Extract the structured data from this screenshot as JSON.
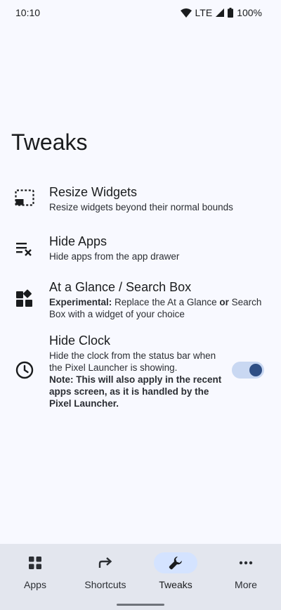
{
  "status_bar": {
    "time": "10:10",
    "network": "LTE",
    "battery": "100%",
    "icons": [
      "wifi-icon",
      "signal-icon",
      "battery-icon"
    ]
  },
  "page": {
    "title": "Tweaks"
  },
  "items": [
    {
      "icon": "resize-widgets-icon",
      "title": "Resize Widgets",
      "description": "Resize widgets beyond their normal bounds"
    },
    {
      "icon": "hide-apps-icon",
      "title": "Hide Apps",
      "description": "Hide apps from the app drawer"
    },
    {
      "icon": "widgets-icon",
      "title": "At a Glance / Search Box",
      "description_parts": {
        "bold1": "Experimental:",
        "text1": " Replace the At a Glance ",
        "bold2": "or",
        "text2": " Search Box with a widget of your choice"
      }
    },
    {
      "icon": "clock-icon",
      "title": "Hide Clock",
      "description": "Hide the clock from the status bar when the Pixel Launcher is showing.",
      "note": "Note: This will also apply in the recent apps screen, as it is handled by the Pixel Launcher.",
      "toggle_on": true
    }
  ],
  "bottom_nav": {
    "items": [
      {
        "label": "Apps",
        "icon": "apps-grid-icon",
        "active": false
      },
      {
        "label": "Shortcuts",
        "icon": "shortcut-arrow-icon",
        "active": false
      },
      {
        "label": "Tweaks",
        "icon": "wrench-icon",
        "active": true
      },
      {
        "label": "More",
        "icon": "more-dots-icon",
        "active": false
      }
    ]
  },
  "colors": {
    "background": "#f8f9ff",
    "nav_background": "#e3e6ee",
    "active_pill": "#d4e3ff",
    "toggle_track": "#c9d8f2",
    "toggle_thumb": "#2f4f85"
  }
}
